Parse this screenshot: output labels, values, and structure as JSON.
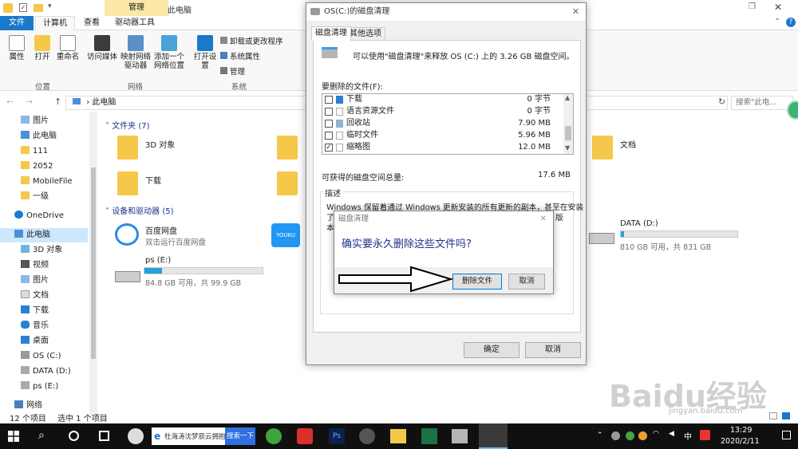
{
  "explorer": {
    "title_tabs": {
      "manage": "管理",
      "location": "此电脑"
    },
    "ribbon_tabs": [
      "文件",
      "计算机",
      "查看",
      "驱动器工具"
    ],
    "ribbon_buttons": [
      "属性",
      "打开",
      "重命名",
      "访问媒体",
      "映射网络驱动器",
      "添加一个网络位置",
      "打开设置"
    ],
    "ribbon_small": [
      "卸载或更改程序",
      "系统属性",
      "管理"
    ],
    "groups": [
      "位置",
      "网络",
      "系统"
    ],
    "address": "此电脑",
    "search_placeholder": "搜索\"此电...",
    "nav_items": [
      "图片",
      "此电脑",
      "111",
      "2052",
      "MobileFile",
      "一级",
      "OneDrive",
      "此电脑",
      "3D 对象",
      "视频",
      "图片",
      "文档",
      "下载",
      "音乐",
      "桌面",
      "OS (C:)",
      "DATA (D:)",
      "ps (E:)",
      "网络"
    ],
    "sections": {
      "folders": "文件夹 (7)",
      "devices": "设备和驱动器 (5)"
    },
    "folders": [
      "3D 对象",
      "下载",
      "文档"
    ],
    "devices": [
      {
        "name": "百度网盘",
        "sub": "双击运行百度网盘"
      },
      {
        "name": "DATA (D:)",
        "sub": "810 GB 可用，共 831 GB",
        "used": 0.025
      },
      {
        "name": "ps (E:)",
        "sub": "84.8 GB 可用，共 99.9 GB",
        "used": 0.151
      }
    ],
    "status": {
      "count": "12 个项目",
      "selected": "选中 1 个项目"
    }
  },
  "cleanup": {
    "title": "OS(C:)的磁盘清理",
    "tabs": [
      "磁盘清理",
      "其他选项"
    ],
    "summary": "可以使用\"磁盘清理\"来释放 OS (C:) 上的 3.26 GB 磁盘空间。",
    "files_label": "要删除的文件(F):",
    "files": [
      {
        "name": "下载",
        "size": "0 字节",
        "checked": false
      },
      {
        "name": "语言资源文件",
        "size": "0 字节",
        "checked": false
      },
      {
        "name": "回收站",
        "size": "7.90 MB",
        "checked": false
      },
      {
        "name": "临时文件",
        "size": "5.96 MB",
        "checked": false
      },
      {
        "name": "缩略图",
        "size": "12.0 MB",
        "checked": true
      }
    ],
    "total_label": "可获得的磁盘空间总量:",
    "total_value": "17.6 MB",
    "desc_label": "描述",
    "desc_text_1": "Windows 保留着通过 Windows 更新安装的所有更新的副本，甚至在安装",
    "desc_text_2": "了",
    "desc_text_2b": "版",
    "desc_text_3": "本",
    "ok": "确定",
    "cancel": "取消"
  },
  "confirm": {
    "title": "磁盘清理",
    "question": "确实要永久删除这些文件吗?",
    "delete": "删除文件",
    "cancel": "取消"
  },
  "taskbar": {
    "search_text": "杜海涛沈梦辰云拥抱",
    "search_btn": "搜索一下",
    "ime": "中",
    "time": "13:29",
    "date": "2020/2/11"
  },
  "watermark": {
    "text": "Baidu经验",
    "url": "jingyan.baidu.com"
  },
  "colors": {
    "accent": "#1979ca",
    "folder": "#f6c84a",
    "taskbar": "#101010",
    "drive_fill": "#26a0da"
  }
}
